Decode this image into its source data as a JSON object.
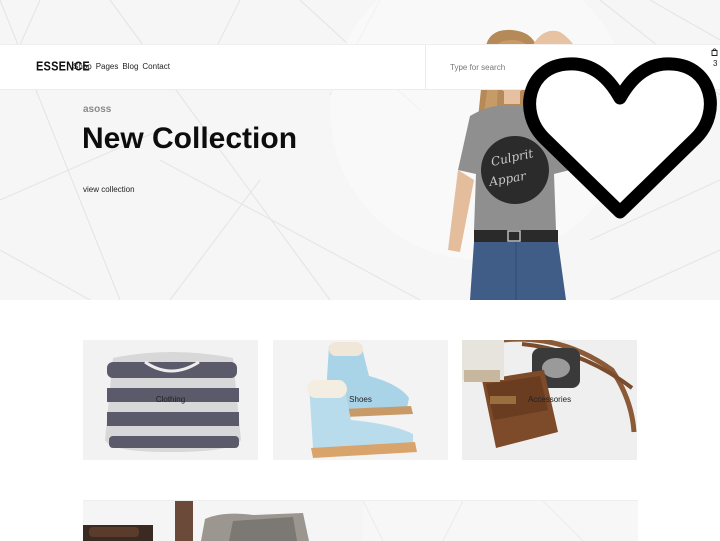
{
  "brand": {
    "logo": "ESSENCE"
  },
  "nav": {
    "items": [
      "Shop",
      "Pages",
      "Blog",
      "Contact"
    ]
  },
  "search": {
    "placeholder": "Type for search"
  },
  "cart": {
    "count": "3",
    "icon": "bag-icon"
  },
  "hero": {
    "eyebrow": "asoss",
    "title": "New Collection",
    "cta": "view collection",
    "shirt_print": [
      "Culprit",
      "Appar"
    ]
  },
  "overlay": {
    "icon": "heart-outline-icon"
  },
  "categories": [
    {
      "label": "Clothing",
      "icon": "sweater-image"
    },
    {
      "label": "Shoes",
      "icon": "boots-image"
    },
    {
      "label": "Accessories",
      "icon": "bag-accessories-image"
    }
  ]
}
